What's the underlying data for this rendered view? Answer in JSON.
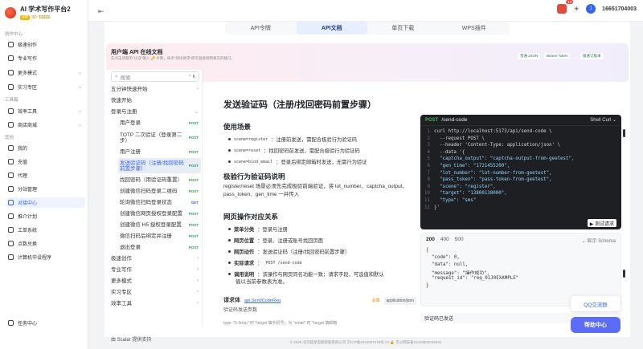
{
  "brand": {
    "title": "AI 学术写作平台2",
    "vip_badge": "VIP",
    "vip_text": "3D: $$$$$"
  },
  "sidebar": {
    "section_creation": "创作中心",
    "section_tools": "工具箱",
    "section_other": "其他",
    "items": [
      {
        "label": "极速创作",
        "top": 0
      },
      {
        "label": "专业写作"
      },
      {
        "label": "更多模式",
        "chev": "⌄"
      },
      {
        "label": "实习专区",
        "chev": "⌄"
      },
      {
        "label": "效率工具",
        "chev": "⌄"
      },
      {
        "label": "商店商城",
        "chev": "⌄"
      },
      {
        "label": "我的"
      },
      {
        "label": "充值"
      },
      {
        "label": "代理"
      },
      {
        "label": "分站管理"
      },
      {
        "label": "对接中心"
      },
      {
        "label": "推介计划"
      },
      {
        "label": "工单系统"
      },
      {
        "label": "点数兑换"
      },
      {
        "label": "计算机毕设程序"
      }
    ]
  },
  "top": {
    "collapse": "⇤",
    "badge": "13",
    "sun": "☀",
    "avatar": "1",
    "user": "16651704003"
  },
  "tabs": [
    {
      "label": "API令牌"
    },
    {
      "label": "API文档"
    },
    {
      "label": "单页下载"
    },
    {
      "label": "WPS插件"
    }
  ],
  "banner": {
    "title": "用户端 API 在线文档",
    "subtitle": "先点击顶部的\"认证\"输入 🔑 令牌，再点\"测试请求\"即可直接调用真实的接口。",
    "badges": [
      "普通 JSON",
      "Bearer Token",
      "极速订版本"
    ]
  },
  "doc_nav": {
    "search_placeholder": "搜索",
    "search_shortcut": "⌃ K",
    "items": [
      {
        "label": "五分钟快速开始",
        "chev": "›"
      },
      {
        "label": "快速开始"
      },
      {
        "label": "登录与注册",
        "chev": "⌄"
      },
      {
        "label": "用户登录",
        "method": "POST"
      },
      {
        "label": "TOTP 二次验证（登录第二步）",
        "method": "POST"
      },
      {
        "label": "用户注册",
        "method": "POST"
      },
      {
        "label": "发送验证码（注册/找回密码前置步骤）",
        "method": "POST"
      },
      {
        "label": "找回密码（用验证码重置）",
        "method": "POST"
      },
      {
        "label": "创建微信扫码登录二维码",
        "method": "POST"
      },
      {
        "label": "轮询微信扫码登录状态",
        "method": "GET"
      },
      {
        "label": "创建微信网页授权登录配置",
        "method": "POST"
      },
      {
        "label": "创建微信 H5 授权登录配置",
        "method": "POST"
      },
      {
        "label": "微信扫码后绑定并注册",
        "method": "POST"
      },
      {
        "label": "退出登录",
        "method": "POST"
      },
      {
        "label": "极速创作",
        "chev": "›"
      },
      {
        "label": "专业写作",
        "chev": "›"
      },
      {
        "label": "更多模式",
        "chev": "›"
      },
      {
        "label": "实习专区",
        "chev": "›"
      },
      {
        "label": "效率工具",
        "chev": "›"
      }
    ],
    "scalar": "由 Scalar 提供支持"
  },
  "doc": {
    "title": "发送验证码（注册/找回密码前置步骤）",
    "usage_title": "使用场景",
    "usage": [
      {
        "code": "scene=register",
        "text": "：注册前发送，需配合极验行为验证码"
      },
      {
        "code": "scene=reset",
        "text": "：找回密码前发送，需配合极验行为验证码"
      },
      {
        "code": "scene=bind_email",
        "text": "：登录后绑定邮箱时发送，无需行为验证"
      }
    ],
    "geetest_title": "极验行为验证码说明",
    "geetest_text": "register/reset 场景必须先完成极验前端验证，将 lot_number、captcha_output、pass_token、gen_time 一并传入",
    "web_title": "网页操作对应关系",
    "web": [
      {
        "k": "菜单分类",
        "v": "：登录与注册"
      },
      {
        "k": "网页位置",
        "v": "：登录、注册或账号找回页面"
      },
      {
        "k": "网页动作",
        "v": "：发送验证码（注册/找回密码前置步骤）"
      },
      {
        "k": "实际请求",
        "v": "：",
        "code": "POST /send-code"
      },
      {
        "k": "调用说明",
        "v": "：该操作与网页同名功能一致；请求字段、可选值和默认"
      }
    ],
    "web_cont": "值以当前参数表为准。",
    "body_label": "请求体",
    "body_link": "api.SendCodeReq",
    "body_required": "必填",
    "body_type": "application/json",
    "body_desc": "验证码发送参数",
    "fade": "type: \"h-5rmp\" 时 *target 填手机号；为 \"email\" 时 *target 填邮箱"
  },
  "code": {
    "method": "POST",
    "path": "/send-code",
    "lang": "Shell Curl ⌄",
    "lines": [
      {
        "n": "1",
        "t": "curl http://localhost:5173/api/send-code \\"
      },
      {
        "n": "2",
        "t": "  --request POST \\"
      },
      {
        "n": "3",
        "t": "  --header 'Content-Type: application/json' \\"
      },
      {
        "n": "4",
        "t": "  --data '{"
      },
      {
        "n": "5",
        "t": "  \"captcha_output\": \"captcha-output-from-geetest\","
      },
      {
        "n": "6",
        "t": "  \"gen_time\": \"1721455200\","
      },
      {
        "n": "7",
        "t": "  \"lot_number\": \"lot-number-from-geetest\","
      },
      {
        "n": "8",
        "t": "  \"pass_token\": \"pass-token-from-geetest\","
      },
      {
        "n": "9",
        "t": "  \"scene\": \"register\","
      },
      {
        "n": "10",
        "t": "  \"target\": \"13800138000\","
      },
      {
        "n": "11",
        "t": "  \"type\": \"sms\""
      },
      {
        "n": "12",
        "t": "}'"
      }
    ],
    "test_btn": "▶ 测试请求"
  },
  "response": {
    "tabs": [
      "200",
      "400",
      "500"
    ],
    "schema": "⌄ 显示 Schema",
    "lines": [
      "{",
      "  \"code\": 0,",
      "  \"data\": null,",
      "  \"message\": \"操作成功\",",
      "  \"request_id\": \"req_01J0EXAMPLE\"",
      "}"
    ],
    "ok": "验证码已发送"
  },
  "float": {
    "qq": "QQ交流群",
    "help": "帮助中心"
  },
  "footer": "© 2025 北京超星电联智能系统公司    京ICP备2024007578号-2J    🔒 京公网安备11010802045631"
}
